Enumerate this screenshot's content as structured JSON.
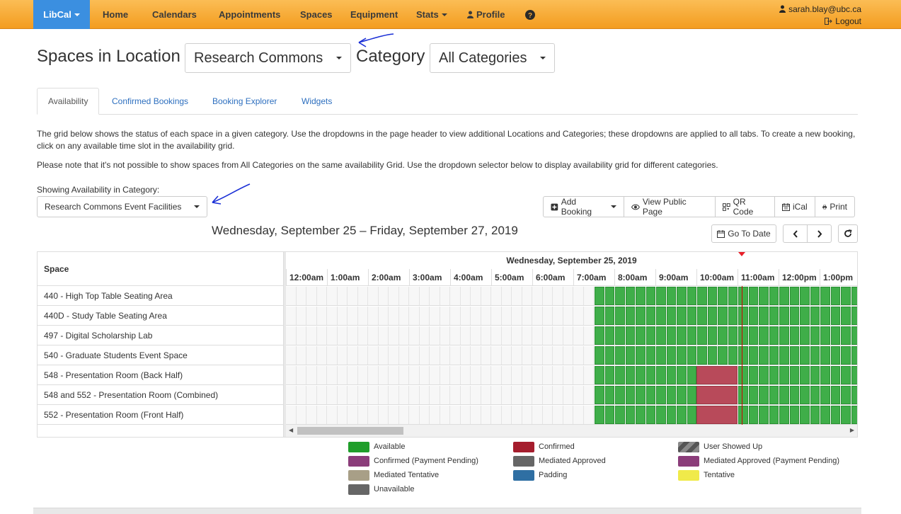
{
  "nav": {
    "brand": "LibCal",
    "items": [
      "Home",
      "Calendars",
      "Appointments",
      "Spaces",
      "Equipment",
      "Stats",
      "Profile"
    ],
    "user_email": "sarah.blay@ubc.ca",
    "logout": "Logout"
  },
  "header": {
    "title": "Spaces in Location",
    "location": "Research Commons",
    "category_label": "Category",
    "category": "All Categories"
  },
  "tabs": [
    "Availability",
    "Confirmed Bookings",
    "Booking Explorer",
    "Widgets"
  ],
  "info": {
    "p1": "The grid below shows the status of each space in a given category. Use the dropdowns in the page header to view additional Locations and Categories; these dropdowns are applied to all tabs. To create a new booking, click on any available time slot in the availability grid.",
    "p2": "Please note that it's not possible to show spaces from All Categories on the same availability Grid. Use the dropdown selector below to display availability grid for different categories."
  },
  "availability": {
    "label": "Showing Availability in Category:",
    "category": "Research Commons Event Facilities"
  },
  "actions": {
    "add_booking": "Add Booking",
    "view_public": "View Public Page",
    "qr_code": "QR Code",
    "ical": "iCal",
    "print": "Print",
    "go_to_date": "Go To Date"
  },
  "date_range": "Wednesday, September 25 – Friday, September 27, 2019",
  "grid": {
    "space_header": "Space",
    "day": "Wednesday, September 25, 2019",
    "hours": [
      "12:00am",
      "1:00am",
      "2:00am",
      "3:00am",
      "4:00am",
      "5:00am",
      "6:00am",
      "7:00am",
      "8:00am",
      "9:00am",
      "10:00am",
      "11:00am",
      "12:00pm",
      "1:00pm"
    ],
    "spaces": [
      "440 - High Top Table Seating Area",
      "440D - Study Table Seating Area",
      "497 - Digital Scholarship Lab",
      "540 - Graduate Students Event Space",
      "548 - Presentation Room (Back Half)",
      "548 and 552 - Presentation Room (Combined)",
      "552 - Presentation Room (Front Half)"
    ]
  },
  "legend": [
    {
      "label": "Available",
      "color": "#1f9e2a"
    },
    {
      "label": "Confirmed",
      "color": "#a51d2d"
    },
    {
      "label": "User Showed Up",
      "color": "#7a7a7a"
    },
    {
      "label": "Confirmed (Payment Pending)",
      "color": "#8b3d7a"
    },
    {
      "label": "Mediated Approved",
      "color": "#666666"
    },
    {
      "label": "Mediated Approved (Payment Pending)",
      "color": "#8b3d7a"
    },
    {
      "label": "Mediated Tentative",
      "color": "#a89f87"
    },
    {
      "label": "Padding",
      "color": "#2f6fa3"
    },
    {
      "label": "Tentative",
      "color": "#f0ea4a"
    },
    {
      "label": "Unavailable",
      "color": "#666666"
    }
  ]
}
